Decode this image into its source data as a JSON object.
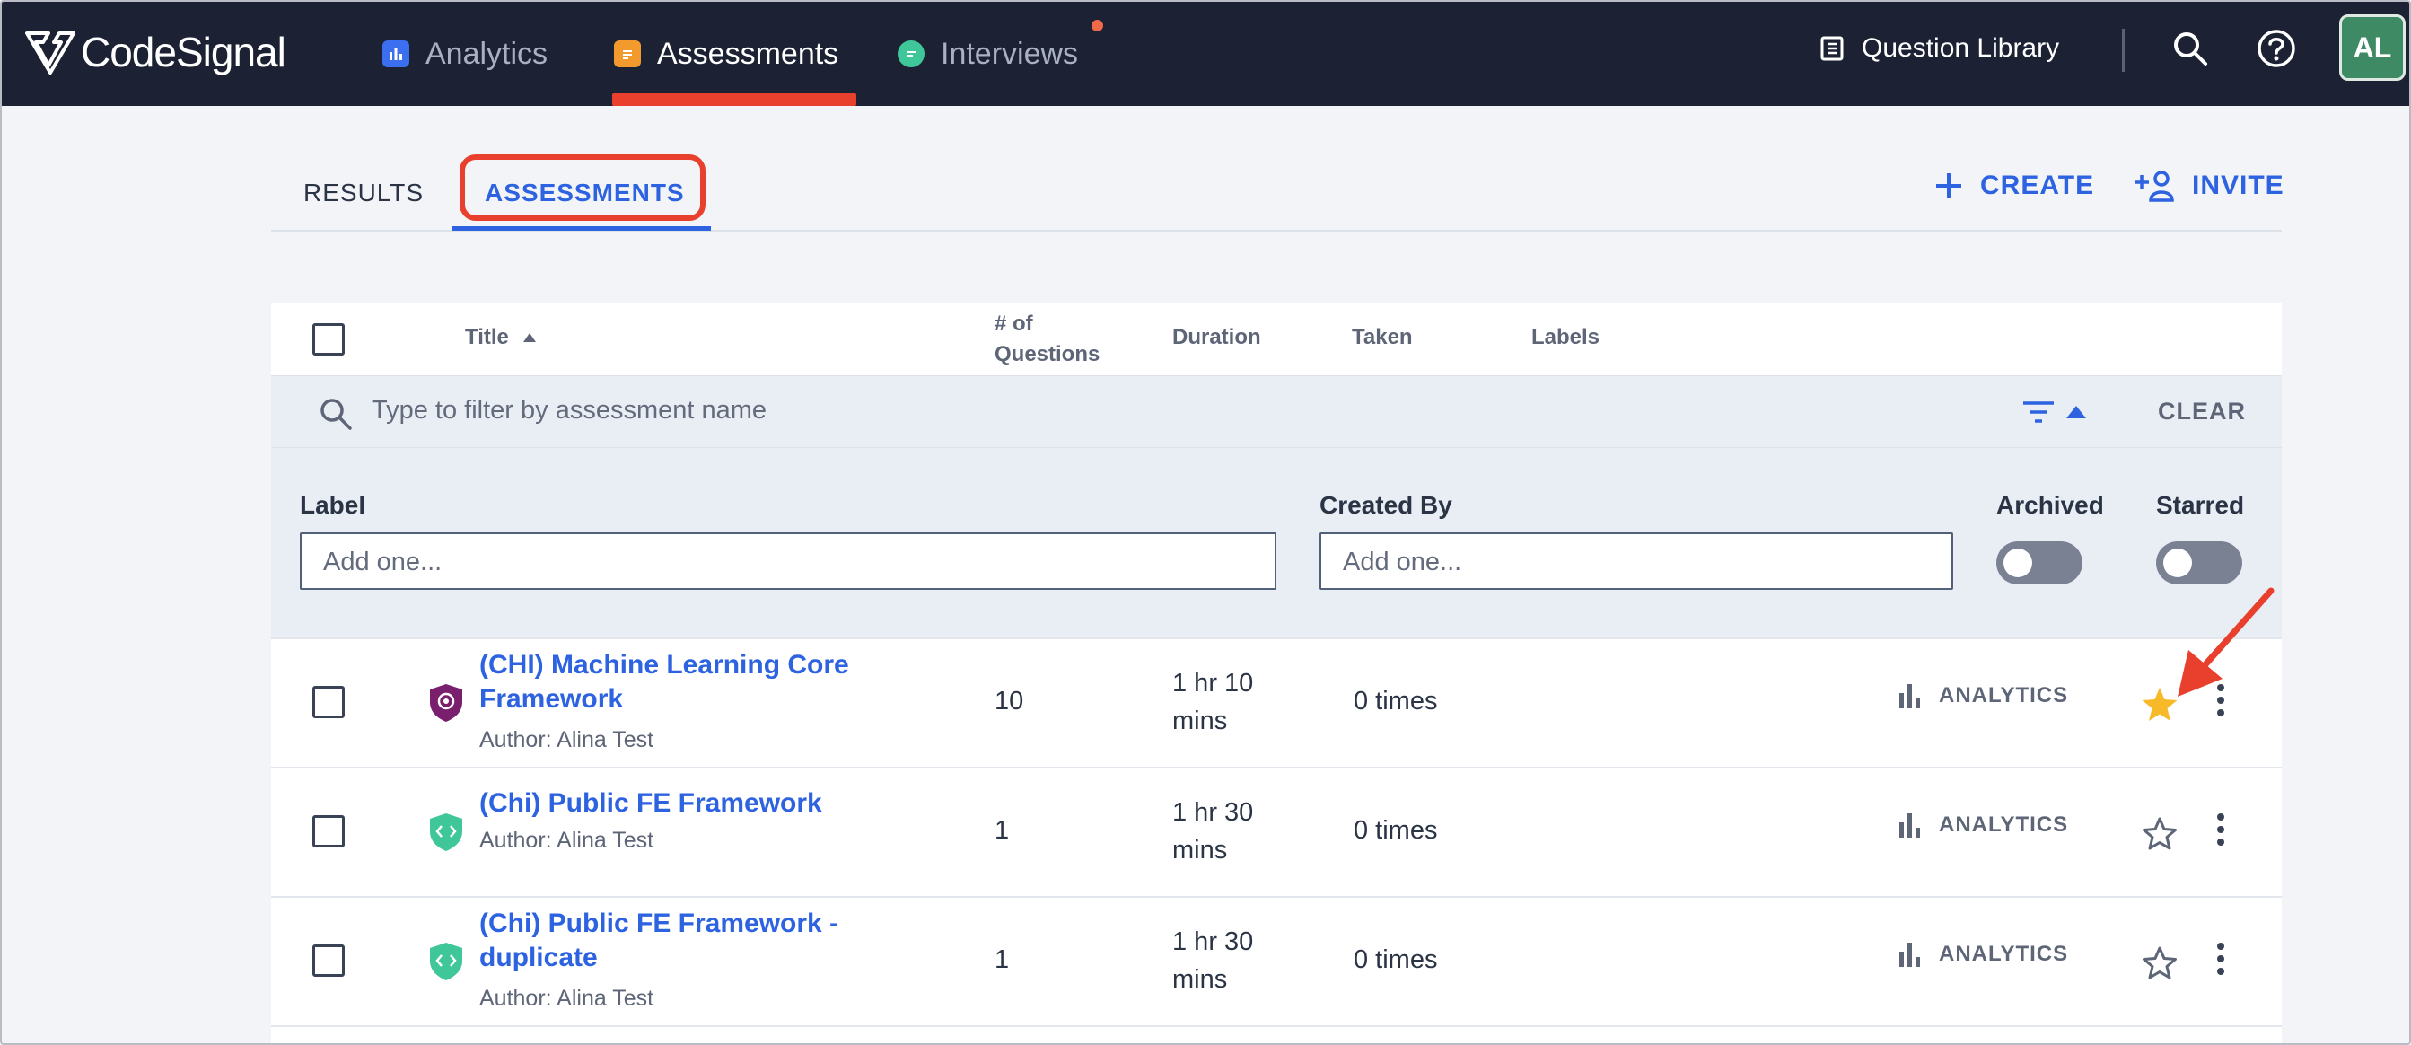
{
  "nav": {
    "brand": "CodeSignal",
    "items": [
      {
        "label": "Analytics",
        "icon": "analytics-icon",
        "active": false
      },
      {
        "label": "Assessments",
        "icon": "assessments-icon",
        "active": true
      },
      {
        "label": "Interviews",
        "icon": "interviews-icon",
        "active": false
      }
    ],
    "question_library": "Question Library",
    "avatar_initials": "AL"
  },
  "tabs": {
    "results": "RESULTS",
    "assessments": "ASSESSMENTS"
  },
  "actions": {
    "create": "CREATE",
    "invite": "INVITE"
  },
  "table": {
    "columns": {
      "title": "Title",
      "questions_line1": "# of",
      "questions_line2": "Questions",
      "duration": "Duration",
      "taken": "Taken",
      "labels": "Labels"
    },
    "filter_placeholder": "Type to filter by assessment name",
    "clear": "CLEAR",
    "filters": {
      "label_title": "Label",
      "label_placeholder": "Add one...",
      "created_by_title": "Created By",
      "created_by_placeholder": "Add one...",
      "archived": "Archived",
      "starred": "Starred"
    },
    "rows": [
      {
        "title_line1": "(CHI) Machine Learning Core",
        "title_line2": "Framework",
        "author": "Author: Alina Test",
        "questions": "10",
        "duration_line1": "1 hr 10",
        "duration_line2": "mins",
        "taken": "0 times",
        "analytics": "ANALYTICS",
        "starred": true,
        "shield_color": "#7a1f6e"
      },
      {
        "title_line1": "(Chi) Public FE Framework",
        "title_line2": "",
        "author": "Author: Alina Test",
        "questions": "1",
        "duration_line1": "1 hr 30",
        "duration_line2": "mins",
        "taken": "0 times",
        "analytics": "ANALYTICS",
        "starred": false,
        "shield_color": "#3fc79a"
      },
      {
        "title_line1": "(Chi) Public FE Framework -",
        "title_line2": "duplicate",
        "author": "Author: Alina Test",
        "questions": "1",
        "duration_line1": "1 hr 30",
        "duration_line2": "mins",
        "taken": "0 times",
        "analytics": "ANALYTICS",
        "starred": false,
        "shield_color": "#3fc79a"
      }
    ]
  },
  "colors": {
    "accent": "#2d62e0",
    "highlight": "#e8402c",
    "star_active": "#f7b928",
    "nav_bg": "#1c2233"
  }
}
